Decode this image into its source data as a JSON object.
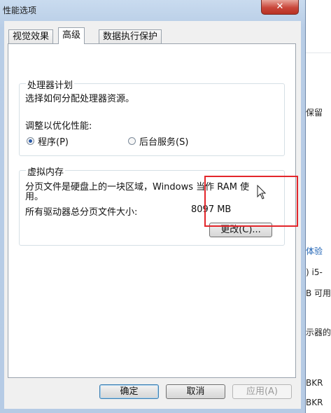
{
  "dialog": {
    "title": "性能选项",
    "close_label": "✕",
    "tabs": [
      {
        "label": "视觉效果"
      },
      {
        "label": "高级"
      },
      {
        "label": "数据执行保护"
      }
    ],
    "processor": {
      "legend": "处理器计划",
      "description": "选择如何分配处理器资源。",
      "adjust_label": "调整以优化性能:",
      "option_programs": "程序(P)",
      "option_services": "后台服务(S)"
    },
    "virtual_memory": {
      "legend": "虚拟内存",
      "description_line1": "分页文件是硬盘上的一块区域，Windows 当作 RAM 使",
      "description_line2": "用。",
      "total_label": "所有驱动器总分页文件大小:",
      "total_value": "8097 MB",
      "change_button": "更改(C)..."
    },
    "buttons": {
      "ok": "确定",
      "cancel": "取消",
      "apply": "应用(A)"
    }
  },
  "background_window": {
    "fragments": [
      "保留",
      "体验",
      ") i5-",
      "B 可用",
      "示器的",
      "BKR",
      "BKR"
    ]
  }
}
